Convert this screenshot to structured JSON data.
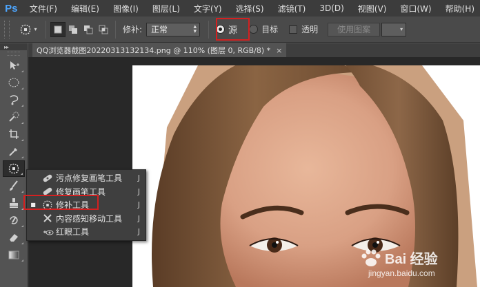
{
  "app": {
    "logo": "Ps"
  },
  "menu": [
    "文件(F)",
    "编辑(E)",
    "图像(I)",
    "图层(L)",
    "文字(Y)",
    "选择(S)",
    "滤镜(T)",
    "3D(D)",
    "视图(V)",
    "窗口(W)",
    "帮助(H)"
  ],
  "options": {
    "patch_label": "修补:",
    "patch_mode": "正常",
    "source_label": "源",
    "target_label": "目标",
    "transparent_label": "透明",
    "use_pattern_label": "使用图案",
    "source_selected": true
  },
  "toolbar": {
    "expand_glyph": "▸▸"
  },
  "document": {
    "tab_title": "QQ浏览器截图20220313132134.png @ 110% (图层 0, RGB/8) *",
    "close_glyph": "×"
  },
  "flyout": {
    "items": [
      {
        "label": "污点修复画笔工具",
        "key": "J",
        "selected": false
      },
      {
        "label": "修复画笔工具",
        "key": "J",
        "selected": false
      },
      {
        "label": "修补工具",
        "key": "J",
        "selected": true
      },
      {
        "label": "内容感知移动工具",
        "key": "J",
        "selected": false
      },
      {
        "label": "红眼工具",
        "key": "J",
        "selected": false
      }
    ]
  },
  "watermark": {
    "brand": "Bai 经验",
    "url": "jingyan.baidu.com"
  },
  "colors": {
    "highlight": "#d42020",
    "menu_bg": "#3c3c3c",
    "panel_bg": "#535353",
    "canvas_bg": "#282828",
    "logo": "#4da6ff"
  }
}
